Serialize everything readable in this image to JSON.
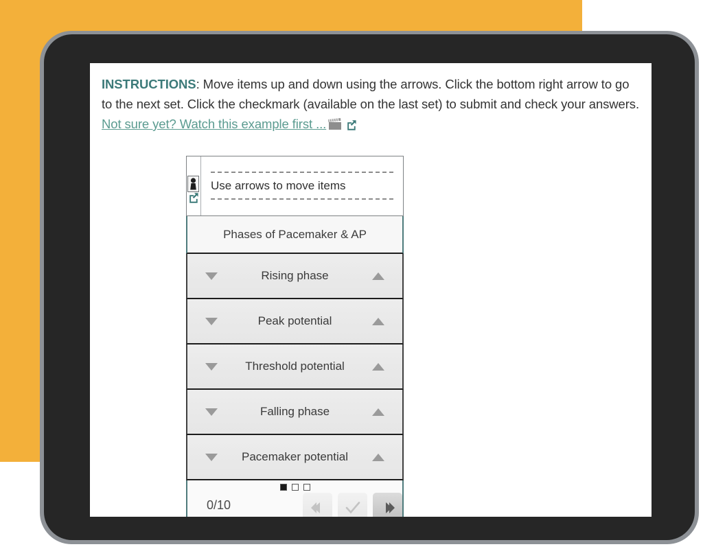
{
  "page": {
    "background_color": "#ffffff",
    "accent_orange": "#F3B03A",
    "bezel_color": "#262626",
    "bezel_rim_color": "#8d9196",
    "teal": "#3C7A79",
    "link_teal": "#5B9B90"
  },
  "instructions": {
    "label": "INSTRUCTIONS",
    "separator": ": ",
    "body": "Move items up and down using the arrows. Click the bottom right arrow to go to the next set. Click the checkmark (available on the last set) to submit and check your answers. ",
    "link_text": "Not sure yet? Watch this example first ...",
    "clapper_icon": "clapperboard-icon",
    "external_link_icon": "external-link-icon"
  },
  "widget": {
    "prompt": {
      "text": "Use arrows to move items",
      "person_icon": "person-silhouette-icon",
      "external_link_icon": "external-link-icon"
    },
    "set_title": "Phases of Pacemaker & AP",
    "items": [
      {
        "label": "Rising phase",
        "down_icon": "arrow-down-icon",
        "up_icon": "arrow-up-icon"
      },
      {
        "label": "Peak potential",
        "down_icon": "arrow-down-icon",
        "up_icon": "arrow-up-icon"
      },
      {
        "label": "Threshold potential",
        "down_icon": "arrow-down-icon",
        "up_icon": "arrow-up-icon"
      },
      {
        "label": "Falling phase",
        "down_icon": "arrow-down-icon",
        "up_icon": "arrow-up-icon"
      },
      {
        "label": "Pacemaker potential",
        "down_icon": "arrow-down-icon",
        "up_icon": "arrow-up-icon"
      }
    ],
    "footer": {
      "score": "0/10",
      "pages": [
        {
          "active": true
        },
        {
          "active": false
        },
        {
          "active": false
        }
      ],
      "buttons": [
        {
          "name": "previous-set-button",
          "icon": "arrow-left-icon",
          "state": "disabled"
        },
        {
          "name": "submit-check-button",
          "icon": "checkmark-icon",
          "state": "disabled"
        },
        {
          "name": "next-set-button",
          "icon": "arrow-right-icon",
          "state": "enabled"
        }
      ]
    }
  }
}
